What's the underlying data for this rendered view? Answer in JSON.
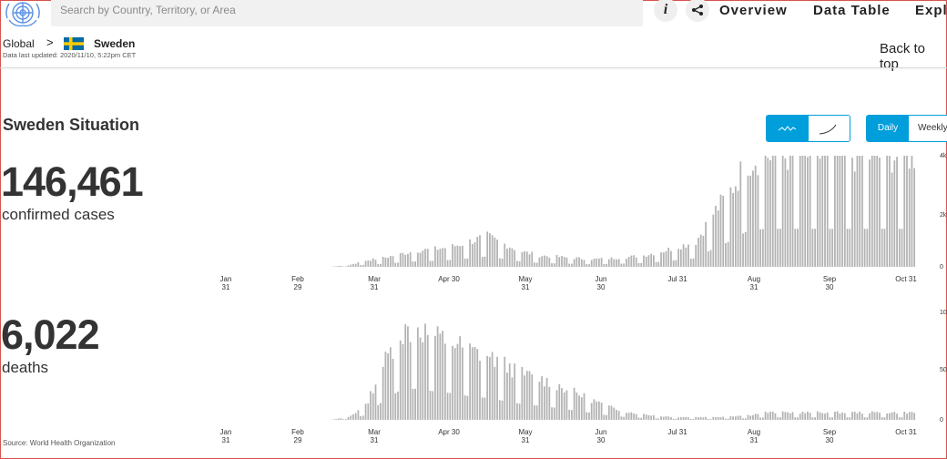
{
  "search": {
    "placeholder": "Search by Country, Territory, or Area"
  },
  "nav": {
    "info_icon": "i",
    "share_icon": "share-icon",
    "items": [
      "Overview",
      "Data Table",
      "Expl"
    ]
  },
  "breadcrumb": {
    "root": "Global",
    "separator": ">",
    "country": "Sweden"
  },
  "updated": "Data last updated: 2020/11/10, 5:22pm CET",
  "back_to_top": "Back to top",
  "situation_title": "Sweden Situation",
  "view_toggle": {
    "linear_icon": "wave-line-icon",
    "cumulative_icon": "rising-curve-icon"
  },
  "period_toggle": {
    "daily": "Daily",
    "weekly": "Weekly"
  },
  "cases": {
    "number": "146,461",
    "caption": "confirmed cases"
  },
  "deaths": {
    "number": "6,022",
    "caption": "deaths"
  },
  "source": "Source: World Health Organization",
  "colors": {
    "accent": "#009edb",
    "bar": "#b3b3b3",
    "text": "#333333",
    "frame": "#d9534f"
  },
  "chart_data": [
    {
      "type": "bar",
      "title": "",
      "x_ticks": [
        {
          "top": "Jan",
          "bottom": "31"
        },
        {
          "top": "Feb",
          "bottom": "29"
        },
        {
          "top": "Mar",
          "bottom": "31"
        },
        {
          "top": "Apr 30",
          "bottom": ""
        },
        {
          "top": "May",
          "bottom": "31"
        },
        {
          "top": "Jun",
          "bottom": "30"
        },
        {
          "top": "Jul 31",
          "bottom": ""
        },
        {
          "top": "Aug",
          "bottom": "31"
        },
        {
          "top": "Sep",
          "bottom": "30"
        },
        {
          "top": "Oct 31",
          "bottom": ""
        }
      ],
      "y_ticks": [
        "4k",
        "2k",
        "0"
      ],
      "ylim": [
        0,
        4500
      ],
      "start_date": "2020-01-31",
      "note": "daily confirmed cases, estimated weekly-pattern values",
      "weekly_values": [
        0,
        0,
        0,
        0,
        2,
        3,
        10,
        60,
        250,
        350,
        500,
        650,
        700,
        800,
        1000,
        1200,
        900,
        600,
        450,
        400,
        350,
        300,
        330,
        380,
        450,
        600,
        800,
        1000,
        2100,
        3000,
        4200,
        4400
      ]
    },
    {
      "type": "bar",
      "title": "",
      "y_ticks": [
        "10",
        "50",
        "0"
      ],
      "ylim": [
        0,
        120
      ],
      "note": "daily deaths, estimated weekly-pattern values",
      "weekly_values": [
        0,
        0,
        0,
        0,
        0,
        0,
        0,
        3,
        15,
        60,
        95,
        100,
        90,
        85,
        75,
        70,
        60,
        50,
        45,
        38,
        30,
        22,
        14,
        9,
        6,
        4,
        3,
        3,
        3,
        4,
        5,
        8
      ]
    }
  ]
}
